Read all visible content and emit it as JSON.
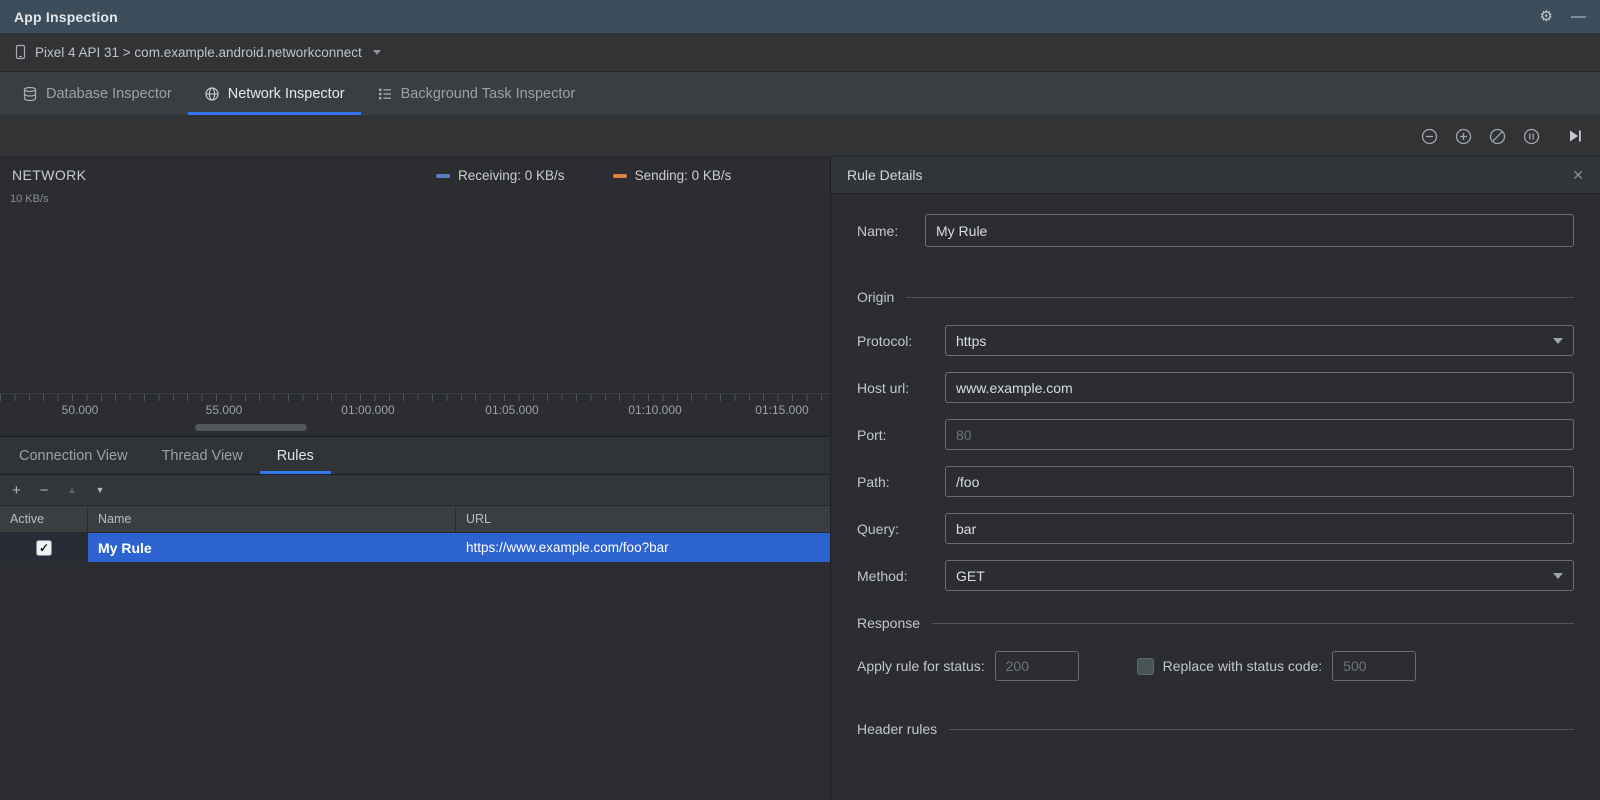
{
  "icons": {
    "gear": "⚙",
    "minimize": "—",
    "close": "✕",
    "check": "✓",
    "plus": "+",
    "minus": "−",
    "arrow_up": "▲",
    "arrow_down": "▼"
  },
  "colors": {
    "accent": "#3574f0",
    "selection_row": "#2d63d1",
    "receiving": "#5b7cc0",
    "sending": "#d9843f"
  },
  "title_bar": {
    "title": "App Inspection"
  },
  "device_bar": {
    "selection": "Pixel 4 API 31 > com.example.android.networkconnect"
  },
  "inspector_tabs": {
    "database": "Database Inspector",
    "network": "Network Inspector",
    "background": "Background Task Inspector"
  },
  "network_chart": {
    "title": "NETWORK",
    "y_max_label": "10 KB/s",
    "legend_receiving": "Receiving: 0 KB/s",
    "legend_sending": "Sending: 0 KB/s",
    "timeline_ticks": [
      "50.000",
      "55.000",
      "01:00.000",
      "01:05.000",
      "01:10.000",
      "01:15.000"
    ]
  },
  "view_tabs": {
    "connection": "Connection View",
    "thread": "Thread View",
    "rules": "Rules"
  },
  "rules_table": {
    "columns": [
      "Active",
      "Name",
      "URL"
    ],
    "rows": [
      {
        "active": true,
        "name": "My Rule",
        "url": "https://www.example.com/foo?bar"
      }
    ]
  },
  "rule_details": {
    "title": "Rule Details",
    "name": {
      "label": "Name:",
      "value": "My Rule"
    },
    "sections": {
      "origin": "Origin",
      "response": "Response",
      "header_rules": "Header rules"
    },
    "origin_fields": [
      {
        "label": "Protocol:",
        "value": "https",
        "control": "dropdown"
      },
      {
        "label": "Host url:",
        "value": "www.example.com",
        "control": "text"
      },
      {
        "label": "Port:",
        "value": "",
        "placeholder": "80",
        "control": "text"
      },
      {
        "label": "Path:",
        "value": "/foo",
        "control": "text"
      },
      {
        "label": "Query:",
        "value": "bar",
        "control": "text"
      },
      {
        "label": "Method:",
        "value": "GET",
        "control": "dropdown"
      }
    ],
    "response": {
      "apply_label": "Apply rule for status:",
      "apply_placeholder": "200",
      "replace_checkbox_checked": false,
      "replace_label": "Replace with status code:",
      "replace_placeholder": "500"
    }
  }
}
